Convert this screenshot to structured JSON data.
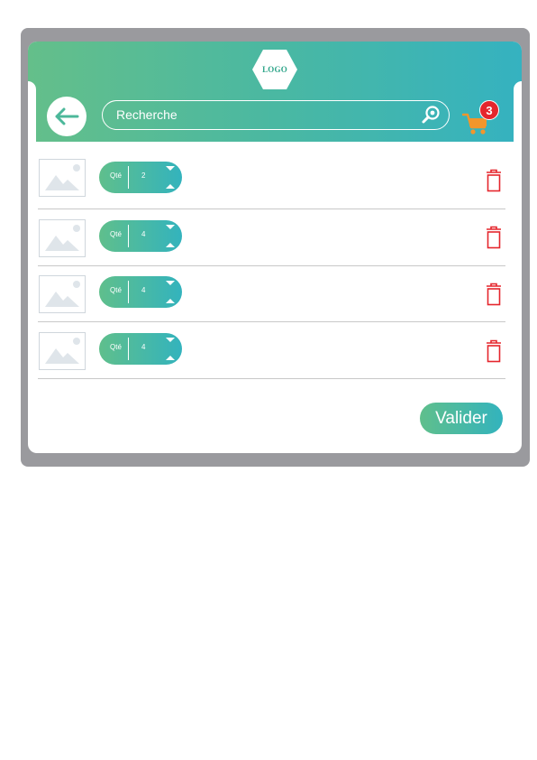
{
  "header": {
    "logo_text": "LOGO",
    "search": {
      "placeholder": "Recherche"
    },
    "cart": {
      "count": "3"
    }
  },
  "cart_items": [
    {
      "qty_label": "Qté",
      "quantity": "2"
    },
    {
      "qty_label": "Qté",
      "quantity": "4"
    },
    {
      "qty_label": "Qté",
      "quantity": "4"
    },
    {
      "qty_label": "Qté",
      "quantity": "4"
    }
  ],
  "footer": {
    "validate_label": "Valider"
  },
  "colors": {
    "gradient_start": "#64bf8a",
    "gradient_end": "#35b2c0",
    "trash": "#e5262d",
    "cart": "#f2962b",
    "device_frame": "#9a9a9e"
  },
  "icons": {
    "back": "arrow-left-icon",
    "search": "search-icon",
    "cart": "cart-icon",
    "delete": "trash-icon",
    "placeholder": "image-placeholder-icon",
    "increase": "chevron-up-icon",
    "decrease": "chevron-down-icon"
  }
}
